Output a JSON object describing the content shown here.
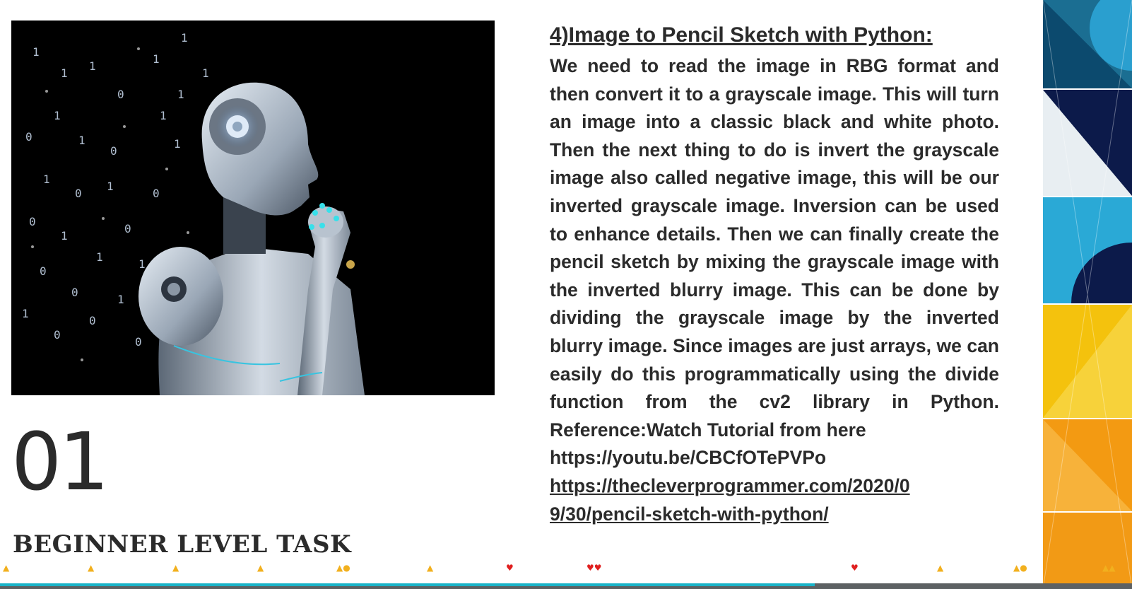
{
  "slide": {
    "number": "01",
    "subtitle": "BEGINNER LEVEL TASK"
  },
  "content": {
    "heading": "4)Image to Pencil Sketch with Python:",
    "body": "We need to read the image in RBG format and then convert it to a grayscale image. This will turn an image into a classic black and white photo. Then the next thing to do is invert the grayscale image also called negative image, this will be our inverted grayscale image. Inversion can be used to enhance details. Then we can finally create the pencil sketch by mixing the grayscale image with the inverted blurry image. This can be done by dividing the grayscale image by the inverted blurry image. Since images are just arrays, we can easily do this programmatically using the divide function from the cv2 library in Python. Reference:Watch Tutorial from here",
    "link_1": "https://youtu.be/CBCfOTePVPo",
    "link_2_line1": "https://thecleverprogrammer.com/2020/0",
    "link_2_line2": "9/30/pencil-sketch-with-python/"
  },
  "progress": {
    "fraction": 0.72
  },
  "colors": {
    "text": "#2b2b2b",
    "accent": "#19b3c8",
    "tile_navy": "#0c1a4a",
    "tile_cyan": "#2aa9d6",
    "tile_yellow": "#f4c20d",
    "tile_orange": "#f39a12"
  },
  "icons": {
    "reaction": "thumbs-up-icon",
    "reaction_alt": "heart-icon"
  }
}
